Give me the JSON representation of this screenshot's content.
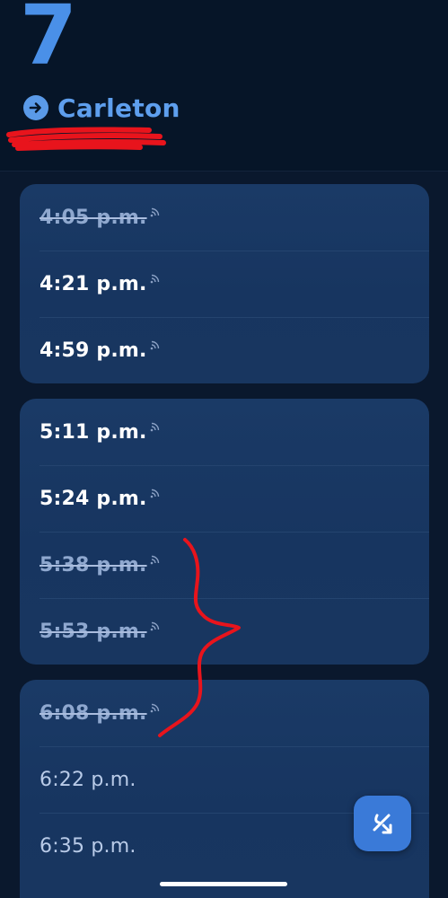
{
  "header": {
    "route_number": "7",
    "direction": "Carleton"
  },
  "groups": [
    {
      "times": [
        {
          "label": "4:05 p.m.",
          "status": "departed",
          "realtime": true
        },
        {
          "label": "4:21 p.m.",
          "status": "live",
          "realtime": true
        },
        {
          "label": "4:59 p.m.",
          "status": "live",
          "realtime": true
        }
      ]
    },
    {
      "times": [
        {
          "label": "5:11 p.m.",
          "status": "live",
          "realtime": true
        },
        {
          "label": "5:24 p.m.",
          "status": "live",
          "realtime": true
        },
        {
          "label": "5:38 p.m.",
          "status": "departed",
          "realtime": true
        },
        {
          "label": "5:53 p.m.",
          "status": "departed",
          "realtime": true
        }
      ]
    },
    {
      "times": [
        {
          "label": "6:08 p.m.",
          "status": "departed",
          "realtime": true
        },
        {
          "label": "6:22 p.m.",
          "status": "scheduled",
          "realtime": false
        },
        {
          "label": "6:35 p.m.",
          "status": "scheduled",
          "realtime": false
        }
      ]
    }
  ],
  "fab": {
    "icon": "percent-transfer-icon"
  },
  "icons": {
    "direction": "arrow-right-circle-icon",
    "realtime": "signal-waves-icon"
  },
  "colors": {
    "accent": "#4a90e8",
    "header_bg": "#061528",
    "card_bg": "#1a3a66",
    "annotation_red": "#e8141c"
  }
}
